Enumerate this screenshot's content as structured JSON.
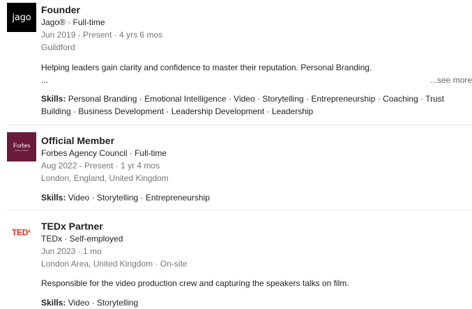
{
  "experience": [
    {
      "logo_text": "jago",
      "title": "Founder",
      "company_line": "Jago® · Full-time",
      "dates": "Jun 2019 - Present · 4 yrs 6 mos",
      "location": "Guildford",
      "description": "Helping leaders gain clarity and confidence to master their reputation. Personal Branding.",
      "ellipsis": "...",
      "see_more": "...see more",
      "skills_label": "Skills:",
      "skills": "Personal Branding · Emotional Intelligence · Video · Storytelling · Entrepreneurship · Coaching · Trust Building · Business Development · Leadership Development · Leadership"
    },
    {
      "logo_text": "Forbes",
      "logo_subtext": "Agency Council",
      "title": "Official Member",
      "company_line": "Forbes Agency Council · Full-time",
      "dates": "Aug 2022 - Present · 1 yr 4 mos",
      "location": "London, England, United Kingdom",
      "skills_label": "Skills:",
      "skills": "Video · Storytelling · Entrepreneurship"
    },
    {
      "logo_text": "TED",
      "logo_sup": "x",
      "title": "TEDx Partner",
      "company_line": "TEDx · Self-employed",
      "dates": "Jun 2023 · 1 mo",
      "location": "London Area, United Kingdom · On-site",
      "description": "Responsible for the video production crew and capturing the speakers talks on film.",
      "skills_label": "Skills:",
      "skills": "Video · Storytelling"
    }
  ],
  "colors": {
    "text": "#1f1f1f",
    "muted": "#767676",
    "divider": "#e5e5e5",
    "forbes_brand": "#6a1b3c",
    "ted_red": "#e62b1e"
  }
}
